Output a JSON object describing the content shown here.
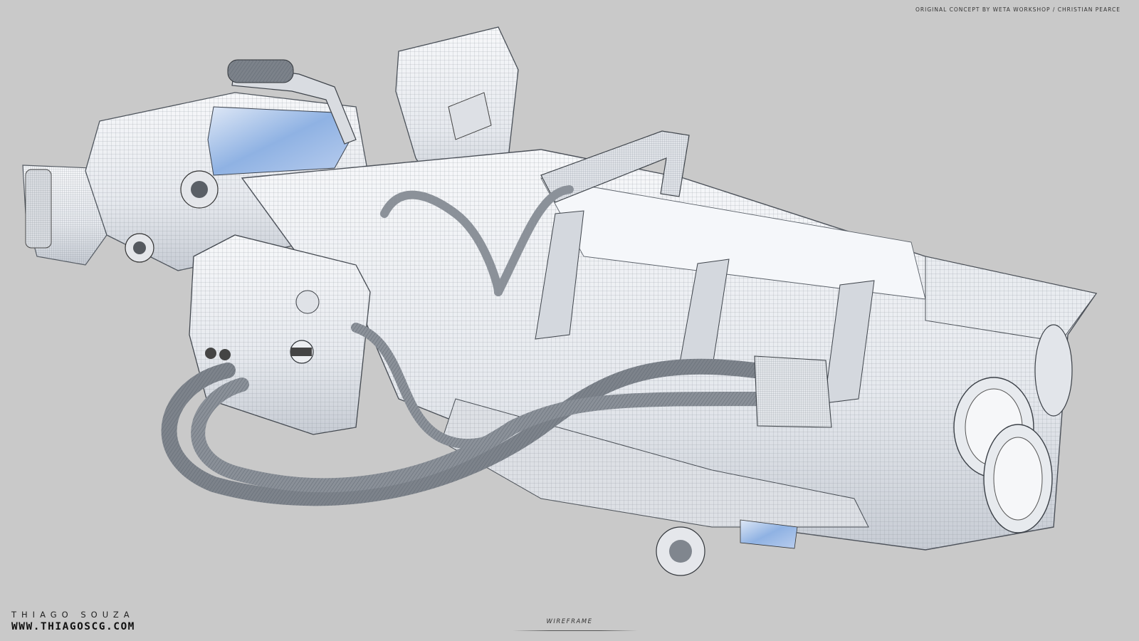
{
  "header": {
    "credit": "ORIGINAL CONCEPT BY WETA WORKSHOP / CHRISTIAN PEARCE"
  },
  "artist": {
    "name": "THIAGO SOUZA",
    "website": "WWW.THIAGOSCG.COM"
  },
  "footer": {
    "caption": "WIREFRAME"
  },
  "colors": {
    "background": "#c9c9c9",
    "body": "#eef0f3",
    "body_shadow": "#cfd3da",
    "wire": "#6b7280",
    "glass_blue": "#8fb2e3"
  },
  "icons": {
    "main_render": "sci-fi-cannon-wireframe-render"
  }
}
